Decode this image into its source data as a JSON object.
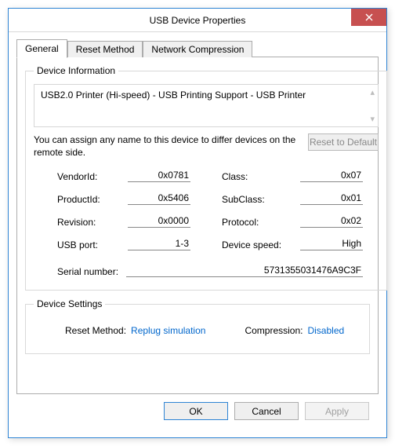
{
  "window": {
    "title": "USB Device Properties"
  },
  "tabs": {
    "general": "General",
    "reset_method": "Reset Method",
    "network_compression": "Network Compression"
  },
  "device_info": {
    "legend": "Device Information",
    "name": "USB2.0 Printer (Hi-speed) - USB Printing Support - USB Printer",
    "assign_text": "You can assign any name to this device to differ devices on the remote side.",
    "reset_default": "Reset to Default",
    "labels": {
      "vendor_id": "VendorId:",
      "product_id": "ProductId:",
      "revision": "Revision:",
      "usb_port": "USB port:",
      "class": "Class:",
      "subclass": "SubClass:",
      "protocol": "Protocol:",
      "device_speed": "Device speed:",
      "serial": "Serial number:"
    },
    "values": {
      "vendor_id": "0x0781",
      "product_id": "0x5406",
      "revision": "0x0000",
      "usb_port": "1-3",
      "class": "0x07",
      "subclass": "0x01",
      "protocol": "0x02",
      "device_speed": "High",
      "serial": "5731355031476A9C3F"
    }
  },
  "device_settings": {
    "legend": "Device Settings",
    "reset_method_label": "Reset Method:",
    "reset_method_value": "Replug simulation",
    "compression_label": "Compression:",
    "compression_value": "Disabled"
  },
  "buttons": {
    "ok": "OK",
    "cancel": "Cancel",
    "apply": "Apply"
  }
}
